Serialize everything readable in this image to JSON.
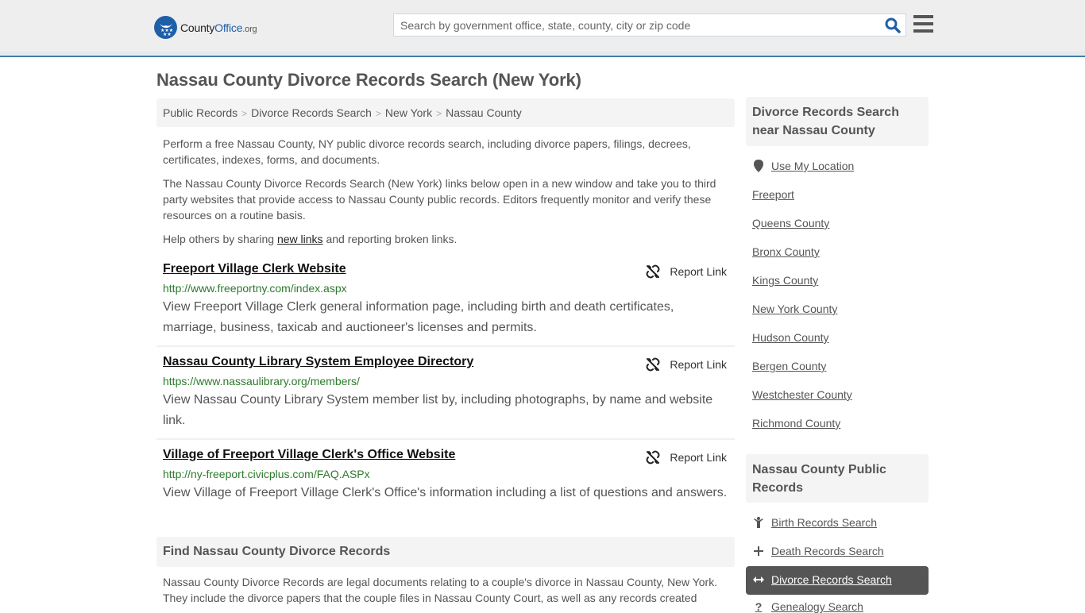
{
  "header": {
    "logo": {
      "part1": "County",
      "part2": "Office",
      "part3": ".org"
    },
    "search_placeholder": "Search by government office, state, county, city or zip code",
    "search_value": ""
  },
  "page": {
    "title": "Nassau County Divorce Records Search (New York)",
    "breadcrumb": [
      "Public Records",
      "Divorce Records Search",
      "New York",
      "Nassau County"
    ],
    "intro": {
      "p1": "Perform a free Nassau County, NY public divorce records search, including divorce papers, filings, decrees, certificates, indexes, forms, and documents.",
      "p2": "The Nassau County Divorce Records Search (New York) links below open in a new window and take you to third party websites that provide access to Nassau County public records. Editors frequently monitor and verify these resources on a routine basis.",
      "p3_before": "Help others by sharing ",
      "p3_link": "new links",
      "p3_after": " and reporting broken links."
    },
    "results": [
      {
        "title": "Freeport Village Clerk Website",
        "url": "http://www.freeportny.com/index.aspx",
        "description": "View Freeport Village Clerk general information page, including birth and death certificates, marriage, business, taxicab and auctioneer's licenses and permits.",
        "report_label": "Report Link"
      },
      {
        "title": "Nassau County Library System Employee Directory",
        "url": "https://www.nassaulibrary.org/members/",
        "description": "View Nassau County Library System member list by, including photographs, by name and website link.",
        "report_label": "Report Link"
      },
      {
        "title": "Village of Freeport Village Clerk's Office Website",
        "url": "http://ny-freeport.civicplus.com/FAQ.ASPx",
        "description": "View Village of Freeport Village Clerk's Office's information including a list of questions and answers.",
        "report_label": "Report Link"
      }
    ],
    "find": {
      "heading": "Find Nassau County Divorce Records",
      "text": "Nassau County Divorce Records are legal documents relating to a couple's divorce in Nassau County, New York. They include the divorce papers that the couple files in Nassau County Court, as well as any records created"
    }
  },
  "sidebar": {
    "nearby": {
      "heading": "Divorce Records Search near Nassau County",
      "use_location": "Use My Location",
      "links": [
        "Freeport",
        "Queens County",
        "Bronx County",
        "Kings County",
        "New York County",
        "Hudson County",
        "Bergen County",
        "Westchester County",
        "Richmond County"
      ]
    },
    "public_records": {
      "heading": "Nassau County Public Records",
      "links": [
        {
          "label": "Birth Records Search",
          "icon": "child-icon"
        },
        {
          "label": "Death Records Search",
          "icon": "plus-icon"
        },
        {
          "label": "Divorce Records Search",
          "icon": "arrows-horizontal-icon",
          "active": true
        },
        {
          "label": "Genealogy Search",
          "icon": "question-icon"
        }
      ]
    }
  },
  "colors": {
    "brand": "#1f5fa8",
    "accent_border": "#3d7eaa",
    "url_green": "#2c7a2c",
    "active_bg": "#555555"
  }
}
